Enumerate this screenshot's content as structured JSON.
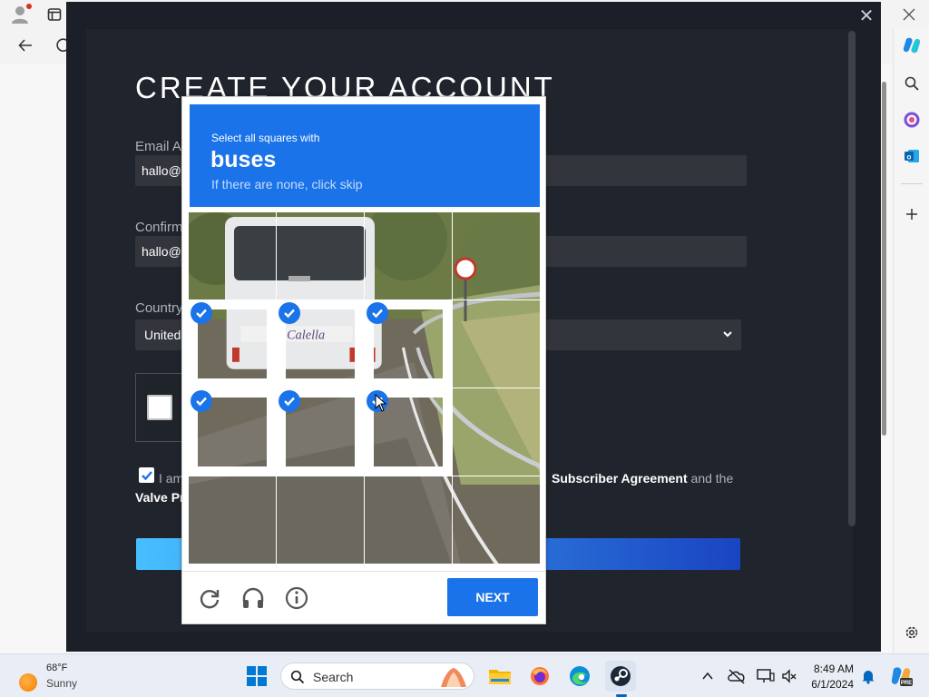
{
  "browser": {
    "address_glyph": "C"
  },
  "steam": {
    "title": "CREATE YOUR ACCOUNT",
    "email_label": "Email Ad",
    "email_value": "hallo@s",
    "confirm_label": "Confirm",
    "confirm_value": "hallo@s",
    "country_label": "Country",
    "country_value": "United",
    "agree_text_start": "I am",
    "agree_subscriber": "Subscriber Agreement",
    "agree_and_the": "and the",
    "agree_valve": "Valve Pr",
    "close_glyph": "✕"
  },
  "captcha": {
    "instruction": "Select all squares with",
    "keyword": "buses",
    "skip_hint": "If there are none, click skip",
    "next_label": "NEXT",
    "selected_tiles": [
      4,
      5,
      6,
      8,
      9,
      10
    ]
  },
  "taskbar": {
    "temperature": "68°F",
    "weather": "Sunny",
    "search_label": "Search",
    "time": "8:49 AM",
    "date": "6/1/2024"
  },
  "colors": {
    "captcha_blue": "#1a73e8",
    "steam_dark": "#1b1f27"
  }
}
